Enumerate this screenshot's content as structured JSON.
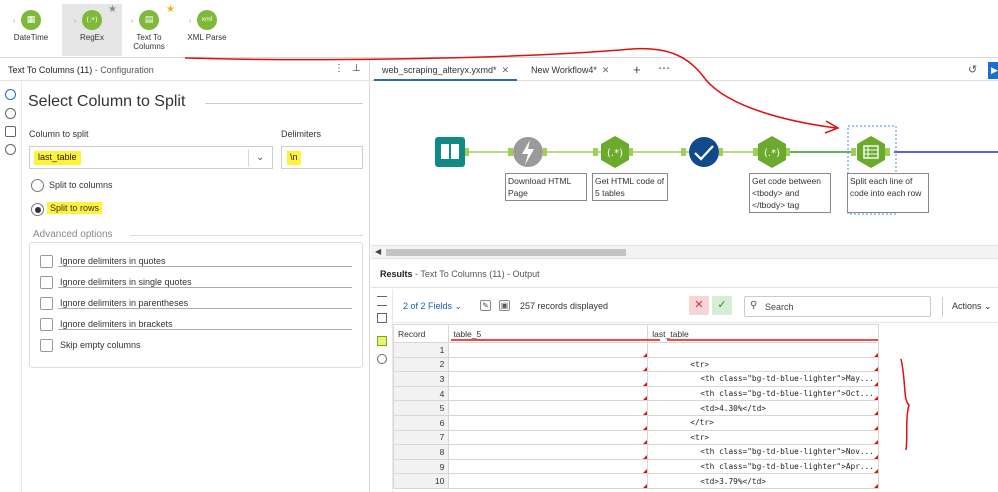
{
  "ribbon": {
    "tools": [
      {
        "label": "DateTime",
        "icon": "datetime-icon",
        "glyph": "▦"
      },
      {
        "label": "RegEx",
        "icon": "regex-icon",
        "glyph": "(.*)"
      },
      {
        "label": "Text To\nColumns",
        "icon": "text-to-columns-icon",
        "glyph": "▤"
      },
      {
        "label": "XML Parse",
        "icon": "xml-parse-icon",
        "glyph": "xml"
      }
    ]
  },
  "config": {
    "tool_name": "Text To Columns (11)",
    "panel_label": "- Configuration",
    "title": "Select Column to Split",
    "column_label": "Column to split",
    "column_value": "last_table",
    "delimiters_label": "Delimiters",
    "delimiters_value": "\\n",
    "radio_columns": "Split to columns",
    "radio_rows": "Split to rows",
    "selected_mode": "rows",
    "advanced_title": "Advanced options",
    "options": [
      "Ignore delimiters in quotes",
      "Ignore delimiters in single quotes",
      "Ignore delimiters in parentheses",
      "Ignore delimiters in brackets",
      "Skip empty columns"
    ]
  },
  "workflow": {
    "tabs": [
      {
        "label": "web_scraping_alteryx.yxmd*",
        "active": true
      },
      {
        "label": "New Workflow4*",
        "active": false
      }
    ],
    "nodes": [
      {
        "label": ""
      },
      {
        "label": "Download HTML Page"
      },
      {
        "label": "Get HTML code of 5 tables"
      },
      {
        "label": ""
      },
      {
        "label": "Get code between <tbody> and </tbody> tag"
      },
      {
        "label": "Split each line of code into each row"
      }
    ]
  },
  "results": {
    "title": "Results",
    "subtitle": "- Text To Columns (11) - Output",
    "fields": "2 of 2 Fields",
    "records": "257 records displayed",
    "search_placeholder": "Search",
    "actions": "Actions",
    "columns": [
      "Record",
      "table_5",
      "last_table"
    ],
    "rows": [
      {
        "n": "1",
        "a": "",
        "b": ""
      },
      {
        "n": "2",
        "a": "",
        "b": "<tr>"
      },
      {
        "n": "3",
        "a": "",
        "b": "<th class=\"bg-td-blue-lighter\">May..."
      },
      {
        "n": "4",
        "a": "",
        "b": "<th class=\"bg-td-blue-lighter\">Oct..."
      },
      {
        "n": "5",
        "a": "",
        "b": "<td>4.30%</td>"
      },
      {
        "n": "6",
        "a": "",
        "b": "</tr>"
      },
      {
        "n": "7",
        "a": "",
        "b": "<tr>"
      },
      {
        "n": "8",
        "a": "",
        "b": "<th class=\"bg-td-blue-lighter\">Nov..."
      },
      {
        "n": "9",
        "a": "",
        "b": "<th class=\"bg-td-blue-lighter\">Apr..."
      },
      {
        "n": "10",
        "a": "",
        "b": "<td>3.79%</td>"
      }
    ]
  },
  "colors": {
    "tool_green": "#7fb93a",
    "tool_blue_dark": "#0f6e8a",
    "tool_navy": "#114a8c",
    "annotation_red": "#e01010",
    "highlight_yellow": "#fff23c",
    "accent_blue": "#1a6fd6"
  }
}
